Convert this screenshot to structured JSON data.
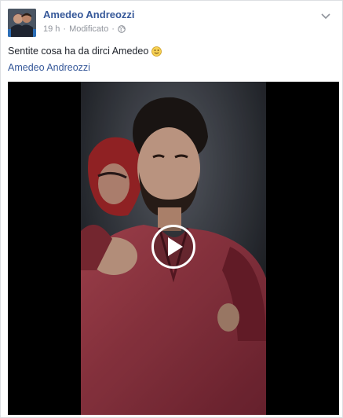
{
  "post": {
    "author": "Amedeo Andreozzi",
    "time": "19 h",
    "separator": "·",
    "edited": "Modificato",
    "privacy_icon": "globe-icon",
    "text": "Sentite cosa ha da dirci Amedeo",
    "text_emoji_icon": "smile-emoji-icon",
    "link_text": "Amedeo Andreozzi",
    "menu_icon": "chevron-down-icon"
  },
  "video": {
    "play_icon": "play-icon"
  },
  "colors": {
    "link": "#365899",
    "meta": "#90949c",
    "text": "#1d2129",
    "video_bg": "#000000",
    "shirt": "#9a3a48"
  }
}
